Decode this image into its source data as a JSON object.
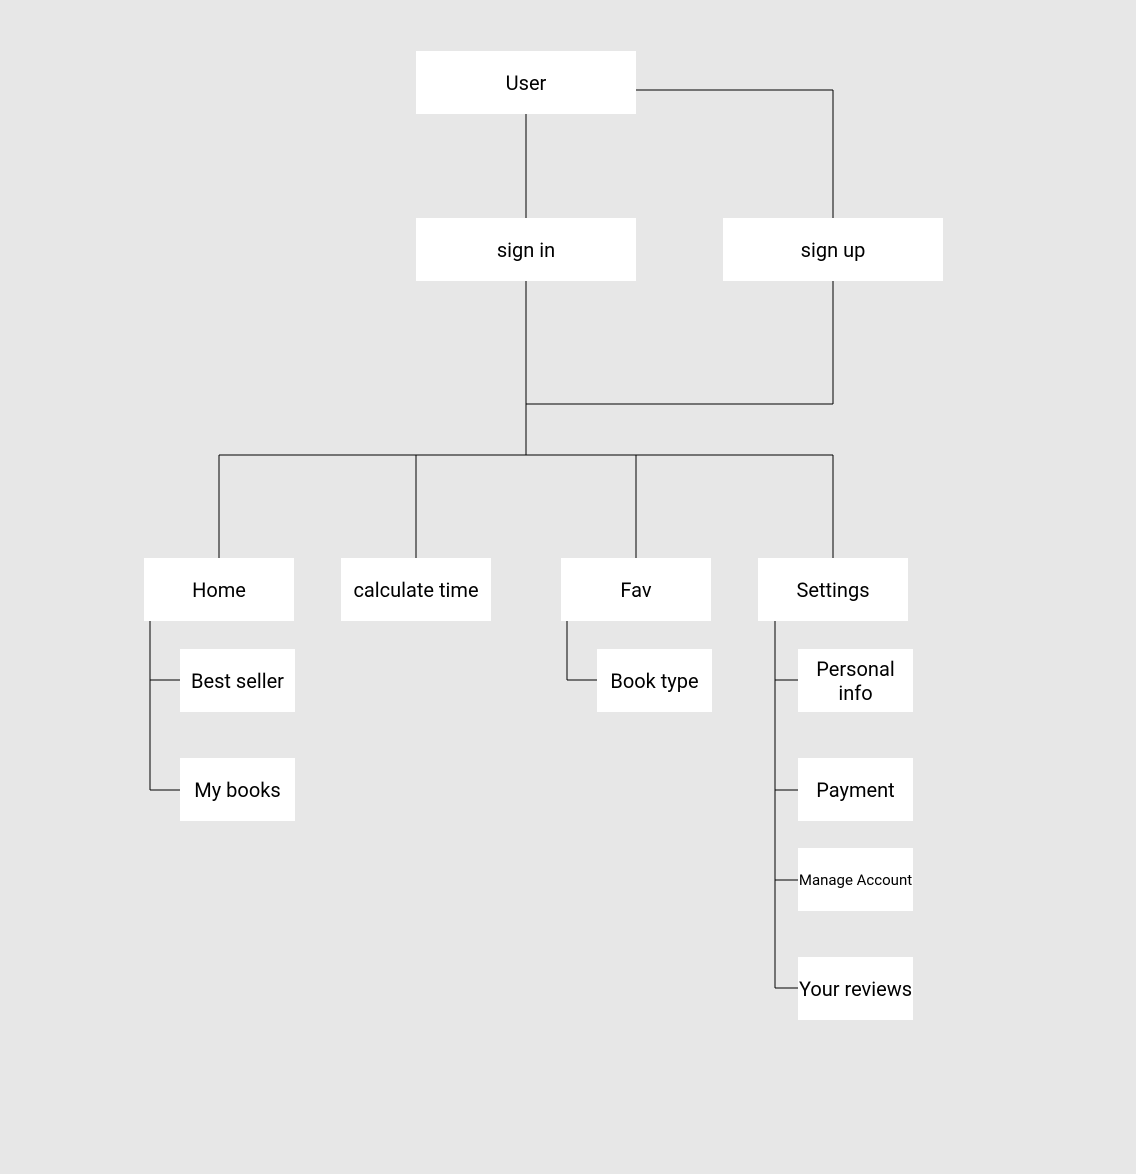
{
  "nodes": {
    "user": "User",
    "sign_in": "sign in",
    "sign_up": "sign up",
    "home": "Home",
    "calculate_time": "calculate time",
    "fav": "Fav",
    "settings": "Settings",
    "best_seller": "Best seller",
    "my_books": "My books",
    "book_type": "Book type",
    "personal_info": "Personal info",
    "payment": "Payment",
    "manage_account": "Manage Account",
    "your_reviews": "Your reviews"
  }
}
